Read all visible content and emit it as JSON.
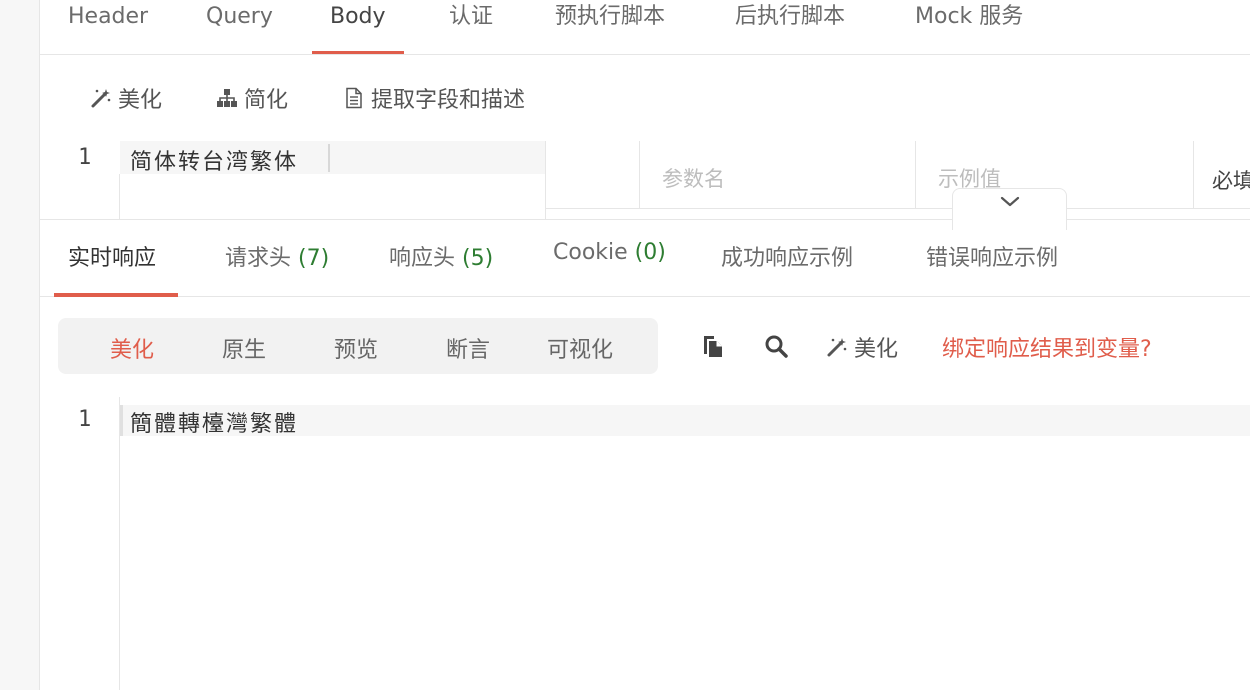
{
  "request_tabs": [
    {
      "label": "Header"
    },
    {
      "label": "Query"
    },
    {
      "label": "Body"
    },
    {
      "label": "认证"
    },
    {
      "label": "预执行脚本"
    },
    {
      "label": "后执行脚本"
    },
    {
      "label": "Mock 服务"
    }
  ],
  "request_active_tab": "Body",
  "body_toolbar": {
    "beautify_label": "美化",
    "simplify_label": "简化",
    "extract_label": "提取字段和描述"
  },
  "request_editor": {
    "line_number": "1",
    "text": "简体转台湾繁体"
  },
  "param_table": {
    "name_placeholder": "参数名",
    "example_placeholder": "示例值",
    "required_header": "必填"
  },
  "response_tabs": [
    {
      "label": "实时响应",
      "count": ""
    },
    {
      "label": "请求头 ",
      "count": "(7)"
    },
    {
      "label": "响应头 ",
      "count": "(5)"
    },
    {
      "label": "Cookie ",
      "count": "(0)"
    },
    {
      "label": "成功响应示例",
      "count": ""
    },
    {
      "label": "错误响应示例",
      "count": ""
    }
  ],
  "response_view_modes": [
    {
      "label": "美化"
    },
    {
      "label": "原生"
    },
    {
      "label": "预览"
    },
    {
      "label": "断言"
    },
    {
      "label": "可视化"
    }
  ],
  "response_toolbar": {
    "beautify_label": "美化",
    "bind_label": "绑定响应结果到变量?"
  },
  "response_editor": {
    "line_number": "1",
    "text": "簡體轉檯灣繁體"
  },
  "icons": {
    "copy": "copy-icon",
    "search": "search-icon",
    "magic_wand": "magic-wand-icon",
    "sitemap": "sitemap-icon",
    "document": "document-icon",
    "chevron": "chevron-down-icon"
  },
  "colors": {
    "accent": "#e05d4b",
    "count_green": "#2e7d32"
  }
}
